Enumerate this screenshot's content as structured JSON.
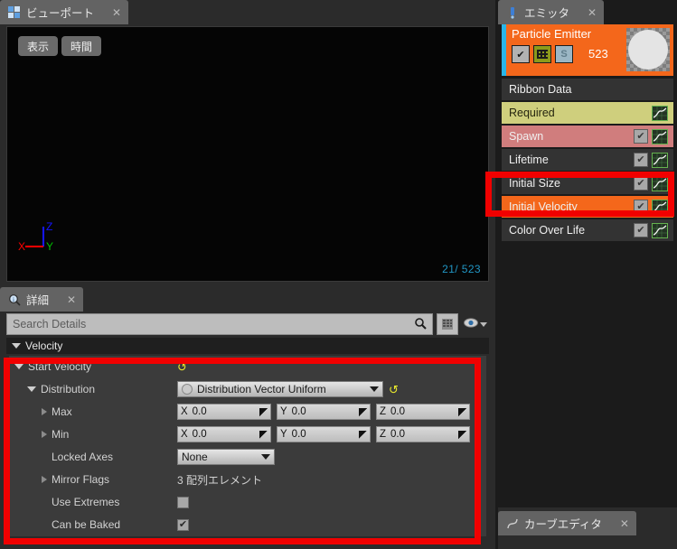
{
  "viewport": {
    "tab_label": "ビューポート",
    "tab_close": "✕",
    "tab_icon": "viewport-grid-icon",
    "buttons": {
      "display": "表示",
      "time": "時間"
    },
    "counter": "21/ 523",
    "gizmo": {
      "x": "X",
      "y": "Y",
      "z": "Z",
      "x_color": "#ff0000",
      "y_color": "#00c000",
      "z_color": "#1515ff"
    }
  },
  "details": {
    "tab_label": "詳細",
    "tab_close": "✕",
    "tab_icon": "magnifier-info-icon",
    "search_placeholder": "Search Details",
    "search_value": "",
    "search_icon": "search-icon",
    "grid_button_icon": "grid-view-icon",
    "eye_button_icon": "eye-icon",
    "eye_dropdown_icon": "chevron-down-icon",
    "category": "Velocity",
    "rows": [
      {
        "label": "Start Velocity",
        "indent": 0,
        "expander": "down",
        "type": "reset"
      },
      {
        "label": "Distribution",
        "indent": 1,
        "expander": "down",
        "type": "combo",
        "value": "Distribution Vector Uniform"
      },
      {
        "label": "Max",
        "indent": 2,
        "expander": "right",
        "type": "vector",
        "vector": [
          {
            "axis": "X",
            "value": "0.0"
          },
          {
            "axis": "Y",
            "value": "0.0"
          },
          {
            "axis": "Z",
            "value": "0.0"
          }
        ]
      },
      {
        "label": "Min",
        "indent": 2,
        "expander": "right",
        "type": "vector",
        "vector": [
          {
            "axis": "X",
            "value": "0.0"
          },
          {
            "axis": "Y",
            "value": "0.0"
          },
          {
            "axis": "Z",
            "value": "0.0"
          }
        ]
      },
      {
        "label": "Locked Axes",
        "indent": 2,
        "expander": "none",
        "type": "combo_plain",
        "value": "None"
      },
      {
        "label": "Mirror Flags",
        "indent": 2,
        "expander": "right",
        "type": "text",
        "value": "3 配列エレメント"
      },
      {
        "label": "Use Extremes",
        "indent": 2,
        "expander": "none",
        "type": "checkbox",
        "checked": false
      },
      {
        "label": "Can be Baked",
        "indent": 2,
        "expander": "none",
        "type": "checkbox",
        "checked": true
      }
    ]
  },
  "emitter": {
    "tab_label": "エミッタ",
    "tab_close": "✕",
    "tab_icon": "particle-emitter-icon",
    "header": {
      "title": "Particle Emitter",
      "count": "523",
      "enable_checkbox_icon": "checkbox-checked-icon",
      "render_button_icon": "grid-pattern-icon",
      "solo_label": "S",
      "thumbnail_icon": "sphere-thumbnail"
    },
    "modules": [
      {
        "label": "Ribbon Data",
        "style": "dark",
        "checkbox": false,
        "graph": false
      },
      {
        "label": "Required",
        "style": "required",
        "checkbox": false,
        "graph": true
      },
      {
        "label": "Spawn",
        "style": "spawn",
        "checkbox": true,
        "graph": true
      },
      {
        "label": "Lifetime",
        "style": "dark",
        "checkbox": true,
        "graph": true
      },
      {
        "label": "Initial Size",
        "style": "dark",
        "checkbox": true,
        "graph": true
      },
      {
        "label": "Initial Velocity",
        "style": "selected",
        "checkbox": true,
        "graph": true
      },
      {
        "label": "Color Over Life",
        "style": "dark",
        "checkbox": true,
        "graph": true
      }
    ]
  },
  "curve_editor": {
    "tab_label": "カーブエディタ",
    "tab_close": "✕",
    "tab_icon": "curve-editor-icon"
  },
  "annotations": {
    "color": "#f10000",
    "module_highlight": "Initial Velocity",
    "details_highlight": "Velocity properties"
  }
}
